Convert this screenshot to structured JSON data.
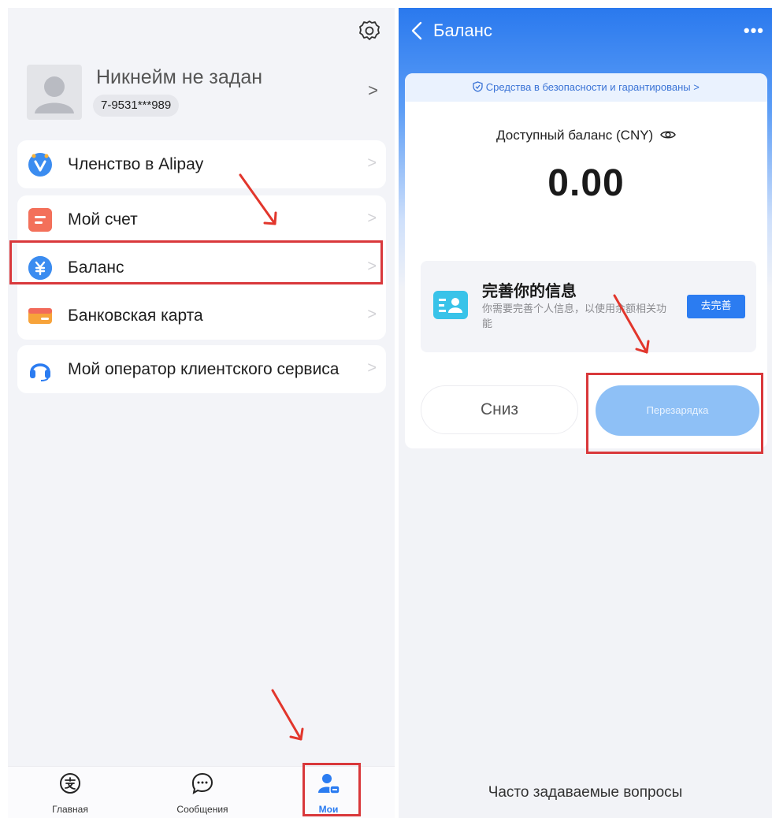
{
  "left": {
    "profile": {
      "nickname": "Никнейм не задан",
      "phone": "7-9531***989",
      "chevron": ">"
    },
    "menu_groups": [
      [
        {
          "label": "Членство в Alipay",
          "icon": "membership-badge-icon",
          "color": "#3b8cf0"
        }
      ],
      [
        {
          "label": "Мой счет",
          "icon": "bill-icon",
          "color": "#f26a5a"
        },
        {
          "label": "Баланс",
          "icon": "yuan-coin-icon",
          "color": "#3b8cf0"
        },
        {
          "label": "Банковская карта",
          "icon": "bank-card-icon",
          "color": "#f7a33a"
        }
      ],
      [
        {
          "label": "Мой оператор клиентского сервиса",
          "icon": "headset-icon",
          "color": "#2b7cf1"
        }
      ]
    ],
    "tabbar": [
      {
        "label": "Главная",
        "icon": "alipay-logo-icon",
        "active": false
      },
      {
        "label": "Сообщения",
        "icon": "chat-bubble-icon",
        "active": false
      },
      {
        "label": "Мои",
        "icon": "user-profile-icon",
        "active": true
      }
    ],
    "chevron": ">"
  },
  "right": {
    "title": "Баланс",
    "more": "•••",
    "safety_banner": "Средства в безопасности и гарантированы >",
    "available_label": "Доступный баланс (CNY)",
    "amount": "0.00",
    "info": {
      "title": "完善你的信息",
      "description": "你需要完善个人信息，以使用余额相关功能",
      "button": "去完善"
    },
    "withdraw_button": "Сниз",
    "topup_button": "Перезарядка",
    "faq": "Часто задаваемые вопросы"
  },
  "colors": {
    "accent_blue": "#2b7cf1",
    "highlight_red": "#d9383b",
    "topup_disabled": "#8ec0f6"
  }
}
